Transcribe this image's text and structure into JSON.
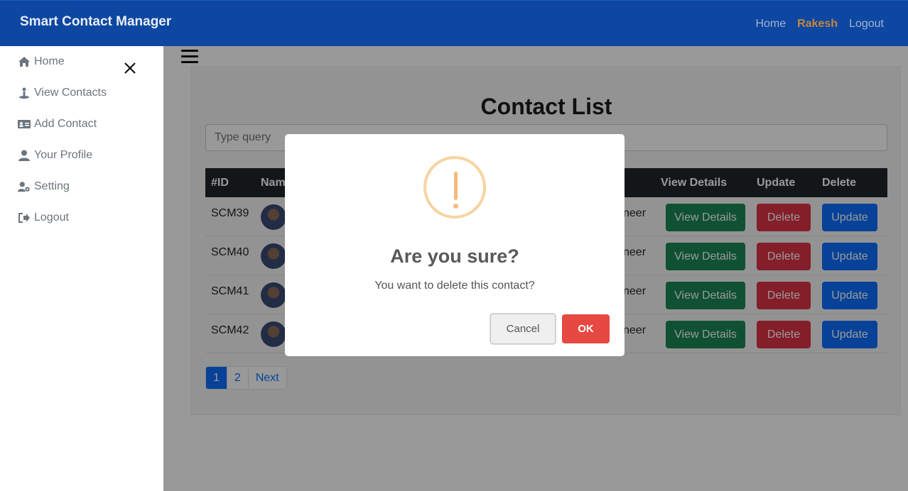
{
  "navbar": {
    "brand": "Smart Contact Manager",
    "links": {
      "home": "Home",
      "user": "Rakesh",
      "logout": "Logout"
    }
  },
  "sidebar": {
    "items": [
      {
        "label": "Home",
        "icon": "home-icon"
      },
      {
        "label": "View Contacts",
        "icon": "contacts-icon"
      },
      {
        "label": "Add Contact",
        "icon": "id-card-icon"
      },
      {
        "label": "Your Profile",
        "icon": "user-icon"
      },
      {
        "label": "Setting",
        "icon": "user-gear-icon"
      },
      {
        "label": "Logout",
        "icon": "sign-out-icon"
      }
    ]
  },
  "main": {
    "title": "Contact List",
    "search_placeholder": "Type query",
    "table": {
      "headers": {
        "id": "#ID",
        "name": "Nam",
        "view": "View Details",
        "update": "Update",
        "delete": "Delete"
      },
      "rows": [
        {
          "id": "SCM39",
          "fragment": "neer"
        },
        {
          "id": "SCM40",
          "fragment": "neer"
        },
        {
          "id": "SCM41",
          "fragment": "neer"
        },
        {
          "id": "SCM42",
          "fragment": "neer"
        }
      ],
      "buttons": {
        "view": "View Details",
        "delete": "Delete",
        "update": "Update"
      }
    },
    "pagination": {
      "page1": "1",
      "page2": "2",
      "next": "Next"
    }
  },
  "dialog": {
    "title": "Are you sure?",
    "text": "You want to delete this contact?",
    "cancel": "Cancel",
    "ok": "OK",
    "icon": "warning-icon"
  },
  "colors": {
    "navbar": "#0d47a1",
    "view_button": "#198754",
    "delete_button": "#dc3545",
    "update_button": "#0d6efd",
    "ok_button": "#e64942",
    "user_link": "#c0873f"
  }
}
